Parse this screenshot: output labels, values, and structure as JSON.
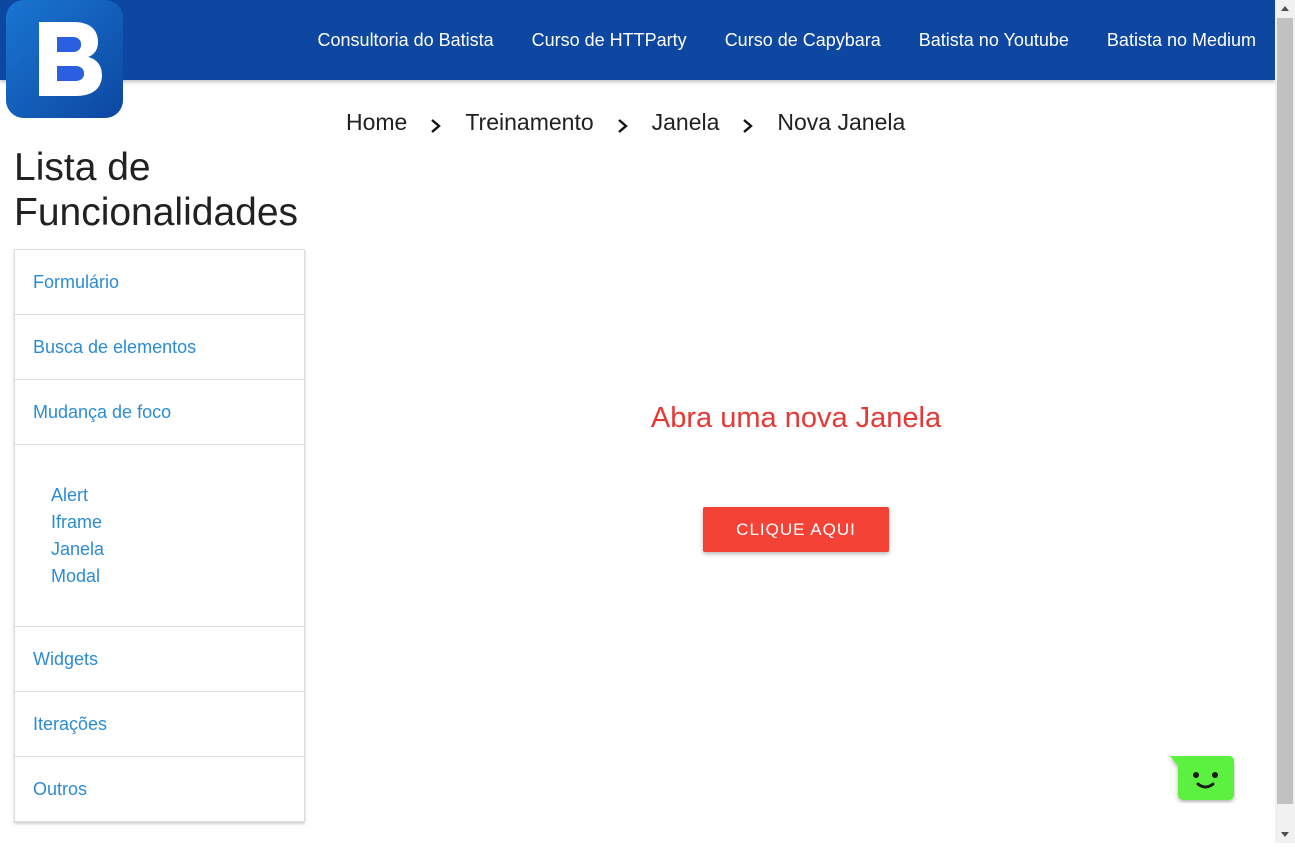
{
  "navbar": {
    "logo_letter": "B",
    "links": [
      {
        "label": "Consultoria do Batista"
      },
      {
        "label": "Curso de HTTParty"
      },
      {
        "label": "Curso de Capybara"
      },
      {
        "label": "Batista no Youtube"
      },
      {
        "label": "Batista no Medium"
      }
    ]
  },
  "breadcrumb": [
    "Home",
    "Treinamento",
    "Janela",
    "Nova Janela"
  ],
  "sidebar": {
    "title": "Lista de Funcionalidades",
    "items": [
      {
        "label": "Formulário"
      },
      {
        "label": "Busca de elementos"
      },
      {
        "label": "Mudança de foco"
      }
    ],
    "subitems": [
      {
        "label": "Alert"
      },
      {
        "label": "Iframe"
      },
      {
        "label": "Janela"
      },
      {
        "label": "Modal"
      }
    ],
    "items_after": [
      {
        "label": "Widgets"
      },
      {
        "label": "Iterações"
      },
      {
        "label": "Outros"
      }
    ]
  },
  "main": {
    "heading": "Abra uma nova Janela",
    "button_label": "CLIQUE AQUI"
  },
  "colors": {
    "navbar": "#0d47a1",
    "link": "#2b8bd5",
    "heading": "#e53935",
    "button": "#f44336",
    "chat": "#5cf040"
  },
  "icons": {
    "logo": "batista-b-logo",
    "breadcrumb_separator": "chevron-right-icon",
    "chat": "smiley-chat-icon"
  }
}
